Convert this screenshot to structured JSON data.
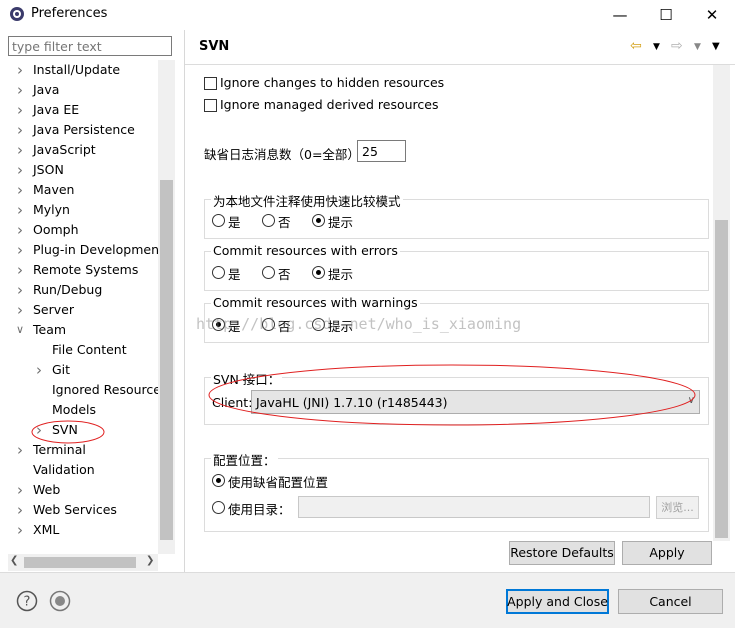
{
  "window": {
    "title": "Preferences"
  },
  "filter": {
    "placeholder": "type filter text"
  },
  "tree": [
    {
      "label": "Install/Update",
      "level": 0,
      "expand": "collapsed"
    },
    {
      "label": "Java",
      "level": 0,
      "expand": "collapsed"
    },
    {
      "label": "Java EE",
      "level": 0,
      "expand": "collapsed"
    },
    {
      "label": "Java Persistence",
      "level": 0,
      "expand": "collapsed"
    },
    {
      "label": "JavaScript",
      "level": 0,
      "expand": "collapsed"
    },
    {
      "label": "JSON",
      "level": 0,
      "expand": "collapsed"
    },
    {
      "label": "Maven",
      "level": 0,
      "expand": "collapsed"
    },
    {
      "label": "Mylyn",
      "level": 0,
      "expand": "collapsed"
    },
    {
      "label": "Oomph",
      "level": 0,
      "expand": "collapsed"
    },
    {
      "label": "Plug-in Development",
      "level": 0,
      "expand": "collapsed"
    },
    {
      "label": "Remote Systems",
      "level": 0,
      "expand": "collapsed"
    },
    {
      "label": "Run/Debug",
      "level": 0,
      "expand": "collapsed"
    },
    {
      "label": "Server",
      "level": 0,
      "expand": "collapsed"
    },
    {
      "label": "Team",
      "level": 0,
      "expand": "expanded"
    },
    {
      "label": "File Content",
      "level": 1,
      "expand": "none"
    },
    {
      "label": "Git",
      "level": 1,
      "expand": "collapsed"
    },
    {
      "label": "Ignored Resources",
      "level": 1,
      "expand": "none"
    },
    {
      "label": "Models",
      "level": 1,
      "expand": "none"
    },
    {
      "label": "SVN",
      "level": 1,
      "expand": "collapsed",
      "selected": true
    },
    {
      "label": "Terminal",
      "level": 0,
      "expand": "collapsed"
    },
    {
      "label": "Validation",
      "level": 0,
      "expand": "none"
    },
    {
      "label": "Web",
      "level": 0,
      "expand": "collapsed"
    },
    {
      "label": "Web Services",
      "level": 0,
      "expand": "collapsed"
    },
    {
      "label": "XML",
      "level": 0,
      "expand": "collapsed"
    }
  ],
  "page": {
    "title": "SVN",
    "ignore_hidden": "Ignore changes to hidden resources",
    "ignore_derived": "Ignore managed derived resources",
    "log_label": "缺省日志消息数（0=全部）",
    "log_value": "25",
    "group1": {
      "title": "为本地文件注释使用快速比较模式",
      "options": [
        "是",
        "否",
        "提示"
      ],
      "selected": 2
    },
    "group2": {
      "title": "Commit resources with errors",
      "options": [
        "是",
        "否",
        "提示"
      ],
      "selected": 2
    },
    "group3": {
      "title": "Commit resources with warnings",
      "options": [
        "是",
        "否",
        "提示"
      ],
      "selected": 0
    },
    "watermark": "http://blog.csdn.net/who_is_xiaoming",
    "svn_group": {
      "title": "SVN 接口：",
      "client_label": "Client:",
      "client_value": "JavaHL (JNI) 1.7.10 (r1485443)"
    },
    "config_group": {
      "title": "配置位置：",
      "default_option": "使用缺省配置位置",
      "dir_option": "使用目录：",
      "browse": "浏览...",
      "selected": 0
    },
    "restore_defaults": "Restore Defaults",
    "apply": "Apply"
  },
  "footer": {
    "apply_close": "Apply and Close",
    "cancel": "Cancel"
  },
  "colors": {
    "annotation": "#e02020",
    "focus": "#0078d7"
  }
}
